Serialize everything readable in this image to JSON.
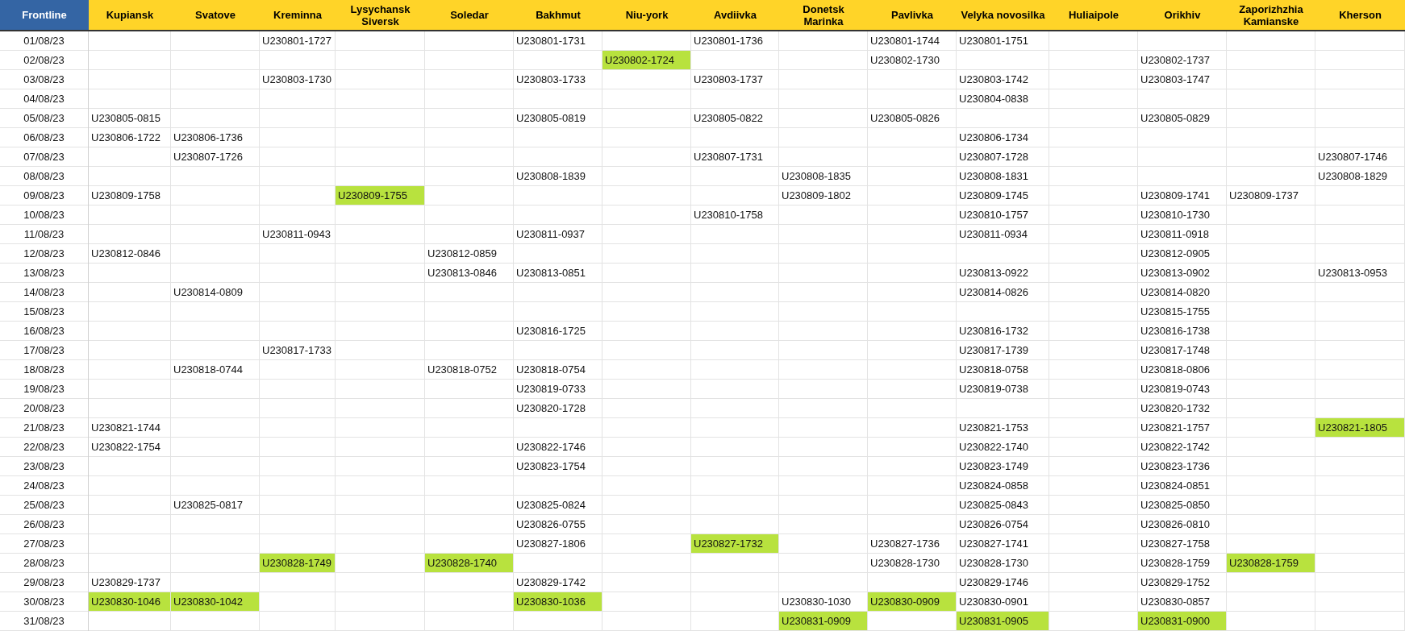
{
  "table": {
    "date_header": "Frontline",
    "columns": [
      {
        "label": "Kupiansk",
        "kind": "location"
      },
      {
        "label": "Svatove",
        "kind": "location"
      },
      {
        "label": "Kreminna",
        "kind": "location"
      },
      {
        "label": "Lysychansk\nSiversk",
        "kind": "location"
      },
      {
        "label": "Soledar",
        "kind": "location"
      },
      {
        "label": "Bakhmut",
        "kind": "location"
      },
      {
        "label": "Niu-york",
        "kind": "location"
      },
      {
        "label": "Avdiivka",
        "kind": "location"
      },
      {
        "label": "Donetsk\nMarinka",
        "kind": "location"
      },
      {
        "label": "Pavlivka",
        "kind": "location"
      },
      {
        "label": "Velyka novosilka",
        "kind": "location"
      },
      {
        "label": "Huliaipole",
        "kind": "location"
      },
      {
        "label": "Orikhiv",
        "kind": "location"
      },
      {
        "label": "Zaporizhzhia\nKamianske",
        "kind": "location"
      },
      {
        "label": "Kherson",
        "kind": "location"
      }
    ],
    "rows": [
      {
        "date": "01/08/23",
        "cells": [
          null,
          null,
          {
            "text": "U230801-1727",
            "highlighted": false
          },
          null,
          null,
          {
            "text": "U230801-1731",
            "highlighted": false
          },
          null,
          {
            "text": "U230801-1736",
            "highlighted": false
          },
          null,
          {
            "text": "U230801-1744",
            "highlighted": false
          },
          {
            "text": "U230801-1751",
            "highlighted": false
          },
          null,
          null,
          null,
          null
        ]
      },
      {
        "date": "02/08/23",
        "cells": [
          null,
          null,
          null,
          null,
          null,
          null,
          {
            "text": "U230802-1724",
            "highlighted": true
          },
          null,
          null,
          {
            "text": "U230802-1730",
            "highlighted": false
          },
          null,
          null,
          {
            "text": "U230802-1737",
            "highlighted": false
          },
          null,
          null
        ]
      },
      {
        "date": "03/08/23",
        "cells": [
          null,
          null,
          {
            "text": "U230803-1730",
            "highlighted": false
          },
          null,
          null,
          {
            "text": "U230803-1733",
            "highlighted": false
          },
          null,
          {
            "text": "U230803-1737",
            "highlighted": false
          },
          null,
          null,
          {
            "text": "U230803-1742",
            "highlighted": false
          },
          null,
          {
            "text": "U230803-1747",
            "highlighted": false
          },
          null,
          null
        ]
      },
      {
        "date": "04/08/23",
        "cells": [
          null,
          null,
          null,
          null,
          null,
          null,
          null,
          null,
          null,
          null,
          {
            "text": "U230804-0838",
            "highlighted": false
          },
          null,
          null,
          null,
          null
        ]
      },
      {
        "date": "05/08/23",
        "cells": [
          {
            "text": "U230805-0815",
            "highlighted": false
          },
          null,
          null,
          null,
          null,
          {
            "text": "U230805-0819",
            "highlighted": false
          },
          null,
          {
            "text": "U230805-0822",
            "highlighted": false
          },
          null,
          {
            "text": "U230805-0826",
            "highlighted": false
          },
          null,
          null,
          {
            "text": "U230805-0829",
            "highlighted": false
          },
          null,
          null
        ]
      },
      {
        "date": "06/08/23",
        "cells": [
          {
            "text": "U230806-1722",
            "highlighted": false
          },
          {
            "text": "U230806-1736",
            "highlighted": false
          },
          null,
          null,
          null,
          null,
          null,
          null,
          null,
          null,
          {
            "text": "U230806-1734",
            "highlighted": false
          },
          null,
          null,
          null,
          null
        ]
      },
      {
        "date": "07/08/23",
        "cells": [
          null,
          {
            "text": "U230807-1726",
            "highlighted": false
          },
          null,
          null,
          null,
          null,
          null,
          {
            "text": "U230807-1731",
            "highlighted": false
          },
          null,
          null,
          {
            "text": "U230807-1728",
            "highlighted": false
          },
          null,
          null,
          null,
          {
            "text": "U230807-1746",
            "highlighted": false
          }
        ]
      },
      {
        "date": "08/08/23",
        "cells": [
          null,
          null,
          null,
          null,
          null,
          {
            "text": "U230808-1839",
            "highlighted": false
          },
          null,
          null,
          {
            "text": "U230808-1835",
            "highlighted": false
          },
          null,
          {
            "text": "U230808-1831",
            "highlighted": false
          },
          null,
          null,
          null,
          {
            "text": "U230808-1829",
            "highlighted": false
          }
        ]
      },
      {
        "date": "09/08/23",
        "cells": [
          {
            "text": "U230809-1758",
            "highlighted": false
          },
          null,
          null,
          {
            "text": "U230809-1755",
            "highlighted": true
          },
          null,
          null,
          null,
          null,
          {
            "text": "U230809-1802",
            "highlighted": false
          },
          null,
          {
            "text": "U230809-1745",
            "highlighted": false
          },
          null,
          {
            "text": "U230809-1741",
            "highlighted": false
          },
          {
            "text": "U230809-1737",
            "highlighted": false
          },
          null
        ]
      },
      {
        "date": "10/08/23",
        "cells": [
          null,
          null,
          null,
          null,
          null,
          null,
          null,
          {
            "text": "U230810-1758",
            "highlighted": false
          },
          null,
          null,
          {
            "text": "U230810-1757",
            "highlighted": false
          },
          null,
          {
            "text": "U230810-1730",
            "highlighted": false
          },
          null,
          null
        ]
      },
      {
        "date": "11/08/23",
        "cells": [
          null,
          null,
          {
            "text": "U230811-0943",
            "highlighted": false
          },
          null,
          null,
          {
            "text": "U230811-0937",
            "highlighted": false
          },
          null,
          null,
          null,
          null,
          {
            "text": "U230811-0934",
            "highlighted": false
          },
          null,
          {
            "text": "U230811-0918",
            "highlighted": false
          },
          null,
          null
        ]
      },
      {
        "date": "12/08/23",
        "cells": [
          {
            "text": "U230812-0846",
            "highlighted": false
          },
          null,
          null,
          null,
          {
            "text": "U230812-0859",
            "highlighted": false
          },
          null,
          null,
          null,
          null,
          null,
          null,
          null,
          {
            "text": "U230812-0905",
            "highlighted": false
          },
          null,
          null
        ]
      },
      {
        "date": "13/08/23",
        "cells": [
          null,
          null,
          null,
          null,
          {
            "text": "U230813-0846",
            "highlighted": false
          },
          {
            "text": "U230813-0851",
            "highlighted": false
          },
          null,
          null,
          null,
          null,
          {
            "text": "U230813-0922",
            "highlighted": false
          },
          null,
          {
            "text": "U230813-0902",
            "highlighted": false
          },
          null,
          {
            "text": "U230813-0953",
            "highlighted": false
          }
        ]
      },
      {
        "date": "14/08/23",
        "cells": [
          null,
          {
            "text": "U230814-0809",
            "highlighted": false
          },
          null,
          null,
          null,
          null,
          null,
          null,
          null,
          null,
          {
            "text": "U230814-0826",
            "highlighted": false
          },
          null,
          {
            "text": "U230814-0820",
            "highlighted": false
          },
          null,
          null
        ]
      },
      {
        "date": "15/08/23",
        "cells": [
          null,
          null,
          null,
          null,
          null,
          null,
          null,
          null,
          null,
          null,
          null,
          null,
          {
            "text": "U230815-1755",
            "highlighted": false
          },
          null,
          null
        ]
      },
      {
        "date": "16/08/23",
        "cells": [
          null,
          null,
          null,
          null,
          null,
          {
            "text": "U230816-1725",
            "highlighted": false
          },
          null,
          null,
          null,
          null,
          {
            "text": "U230816-1732",
            "highlighted": false
          },
          null,
          {
            "text": "U230816-1738",
            "highlighted": false
          },
          null,
          null
        ]
      },
      {
        "date": "17/08/23",
        "cells": [
          null,
          null,
          {
            "text": "U230817-1733",
            "highlighted": false
          },
          null,
          null,
          null,
          null,
          null,
          null,
          null,
          {
            "text": "U230817-1739",
            "highlighted": false
          },
          null,
          {
            "text": "U230817-1748",
            "highlighted": false
          },
          null,
          null
        ]
      },
      {
        "date": "18/08/23",
        "cells": [
          null,
          {
            "text": "U230818-0744",
            "highlighted": false
          },
          null,
          null,
          {
            "text": "U230818-0752",
            "highlighted": false
          },
          {
            "text": "U230818-0754",
            "highlighted": false
          },
          null,
          null,
          null,
          null,
          {
            "text": "U230818-0758",
            "highlighted": false
          },
          null,
          {
            "text": "U230818-0806",
            "highlighted": false
          },
          null,
          null
        ]
      },
      {
        "date": "19/08/23",
        "cells": [
          null,
          null,
          null,
          null,
          null,
          {
            "text": "U230819-0733",
            "highlighted": false
          },
          null,
          null,
          null,
          null,
          {
            "text": "U230819-0738",
            "highlighted": false
          },
          null,
          {
            "text": "U230819-0743",
            "highlighted": false
          },
          null,
          null
        ]
      },
      {
        "date": "20/08/23",
        "cells": [
          null,
          null,
          null,
          null,
          null,
          {
            "text": "U230820-1728",
            "highlighted": false
          },
          null,
          null,
          null,
          null,
          null,
          null,
          {
            "text": "U230820-1732",
            "highlighted": false
          },
          null,
          null
        ]
      },
      {
        "date": "21/08/23",
        "cells": [
          {
            "text": "U230821-1744",
            "highlighted": false
          },
          null,
          null,
          null,
          null,
          null,
          null,
          null,
          null,
          null,
          {
            "text": "U230821-1753",
            "highlighted": false
          },
          null,
          {
            "text": "U230821-1757",
            "highlighted": false
          },
          null,
          {
            "text": "U230821-1805",
            "highlighted": true
          }
        ]
      },
      {
        "date": "22/08/23",
        "cells": [
          {
            "text": "U230822-1754",
            "highlighted": false
          },
          null,
          null,
          null,
          null,
          {
            "text": "U230822-1746",
            "highlighted": false
          },
          null,
          null,
          null,
          null,
          {
            "text": "U230822-1740",
            "highlighted": false
          },
          null,
          {
            "text": "U230822-1742",
            "highlighted": false
          },
          null,
          null
        ]
      },
      {
        "date": "23/08/23",
        "cells": [
          null,
          null,
          null,
          null,
          null,
          {
            "text": "U230823-1754",
            "highlighted": false
          },
          null,
          null,
          null,
          null,
          {
            "text": "U230823-1749",
            "highlighted": false
          },
          null,
          {
            "text": "U230823-1736",
            "highlighted": false
          },
          null,
          null
        ]
      },
      {
        "date": "24/08/23",
        "cells": [
          null,
          null,
          null,
          null,
          null,
          null,
          null,
          null,
          null,
          null,
          {
            "text": "U230824-0858",
            "highlighted": false
          },
          null,
          {
            "text": "U230824-0851",
            "highlighted": false
          },
          null,
          null
        ]
      },
      {
        "date": "25/08/23",
        "cells": [
          null,
          {
            "text": "U230825-0817",
            "highlighted": false
          },
          null,
          null,
          null,
          {
            "text": "U230825-0824",
            "highlighted": false
          },
          null,
          null,
          null,
          null,
          {
            "text": "U230825-0843",
            "highlighted": false
          },
          null,
          {
            "text": "U230825-0850",
            "highlighted": false
          },
          null,
          null
        ]
      },
      {
        "date": "26/08/23",
        "cells": [
          null,
          null,
          null,
          null,
          null,
          {
            "text": "U230826-0755",
            "highlighted": false
          },
          null,
          null,
          null,
          null,
          {
            "text": "U230826-0754",
            "highlighted": false
          },
          null,
          {
            "text": "U230826-0810",
            "highlighted": false
          },
          null,
          null
        ]
      },
      {
        "date": "27/08/23",
        "cells": [
          null,
          null,
          null,
          null,
          null,
          {
            "text": "U230827-1806",
            "highlighted": false
          },
          null,
          {
            "text": "U230827-1732",
            "highlighted": true
          },
          null,
          {
            "text": "U230827-1736",
            "highlighted": false
          },
          {
            "text": "U230827-1741",
            "highlighted": false
          },
          null,
          {
            "text": "U230827-1758",
            "highlighted": false
          },
          null,
          null
        ]
      },
      {
        "date": "28/08/23",
        "cells": [
          null,
          null,
          {
            "text": "U230828-1749",
            "highlighted": true
          },
          null,
          {
            "text": "U230828-1740",
            "highlighted": true
          },
          null,
          null,
          null,
          null,
          {
            "text": "U230828-1730",
            "highlighted": false
          },
          {
            "text": "U230828-1730",
            "highlighted": false
          },
          null,
          {
            "text": "U230828-1759",
            "highlighted": false
          },
          {
            "text": "U230828-1759",
            "highlighted": true
          },
          null
        ]
      },
      {
        "date": "29/08/23",
        "cells": [
          {
            "text": "U230829-1737",
            "highlighted": false
          },
          null,
          null,
          null,
          null,
          {
            "text": "U230829-1742",
            "highlighted": false
          },
          null,
          null,
          null,
          null,
          {
            "text": "U230829-1746",
            "highlighted": false
          },
          null,
          {
            "text": "U230829-1752",
            "highlighted": false
          },
          null,
          null
        ]
      },
      {
        "date": "30/08/23",
        "cells": [
          {
            "text": "U230830-1046",
            "highlighted": true
          },
          {
            "text": "U230830-1042",
            "highlighted": true
          },
          null,
          null,
          null,
          {
            "text": "U230830-1036",
            "highlighted": true
          },
          null,
          null,
          {
            "text": "U230830-1030",
            "highlighted": false
          },
          {
            "text": "U230830-0909",
            "highlighted": true
          },
          {
            "text": "U230830-0901",
            "highlighted": false
          },
          null,
          {
            "text": "U230830-0857",
            "highlighted": false
          },
          null,
          null
        ]
      },
      {
        "date": "31/08/23",
        "cells": [
          null,
          null,
          null,
          null,
          null,
          null,
          null,
          null,
          {
            "text": "U230831-0909",
            "highlighted": true
          },
          null,
          {
            "text": "U230831-0905",
            "highlighted": true
          },
          null,
          {
            "text": "U230831-0900",
            "highlighted": true
          },
          null,
          null
        ]
      }
    ]
  }
}
